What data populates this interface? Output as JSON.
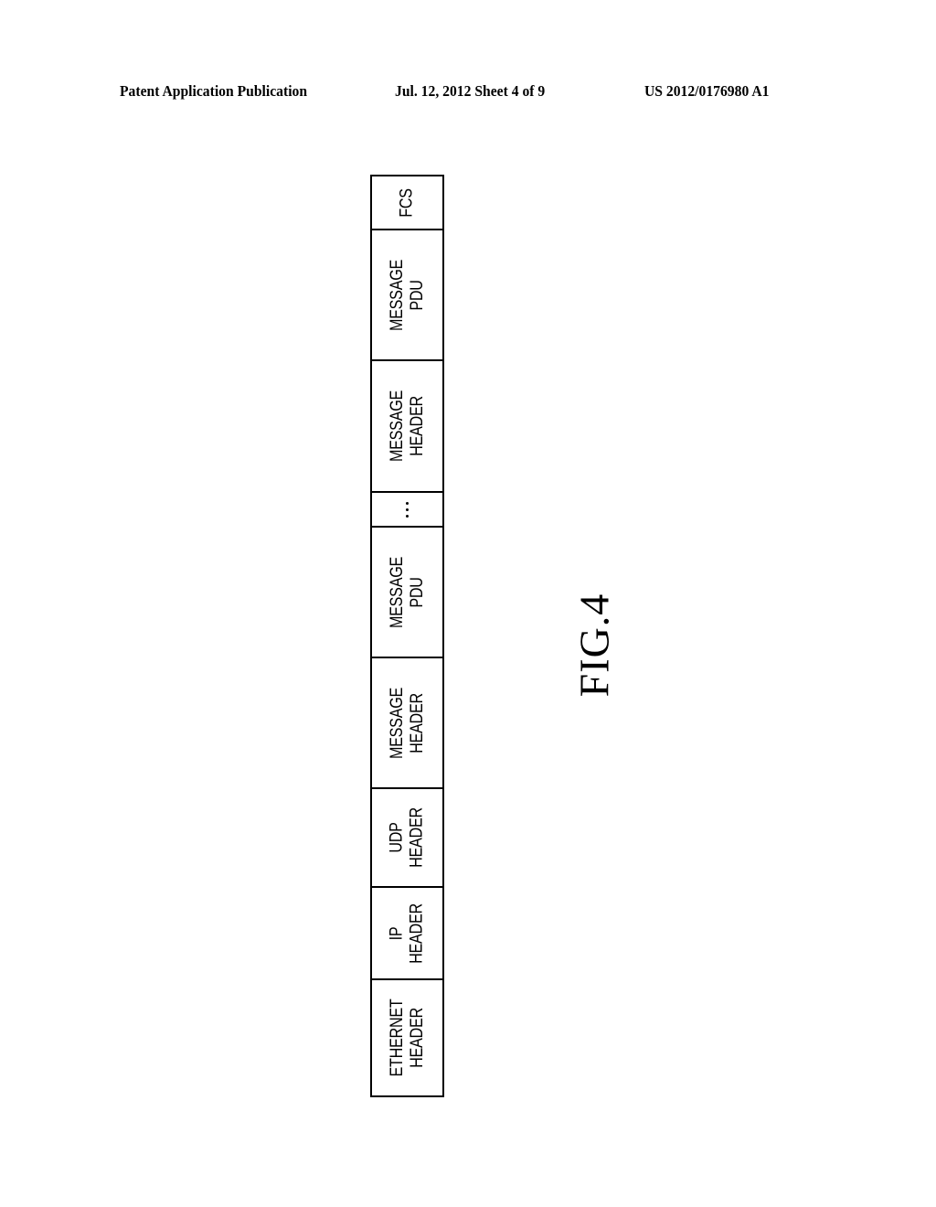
{
  "header": {
    "publication_type": "Patent Application Publication",
    "date_sheet": "Jul. 12, 2012   Sheet 4 of 9",
    "pub_number": "US 2012/0176980 A1"
  },
  "figure": {
    "label": "FIG.4",
    "segments_top_to_bottom": [
      {
        "label": "FCS"
      },
      {
        "label": "MESSAGE\nPDU"
      },
      {
        "label": "MESSAGE\nHEADER"
      },
      {
        "label": "...",
        "ellipsis": true
      },
      {
        "label": "MESSAGE\nPDU"
      },
      {
        "label": "MESSAGE\nHEADER"
      },
      {
        "label": "UDP\nHEADER"
      },
      {
        "label": "IP\nHEADER"
      },
      {
        "label": "ETHERNET\nHEADER"
      }
    ]
  }
}
